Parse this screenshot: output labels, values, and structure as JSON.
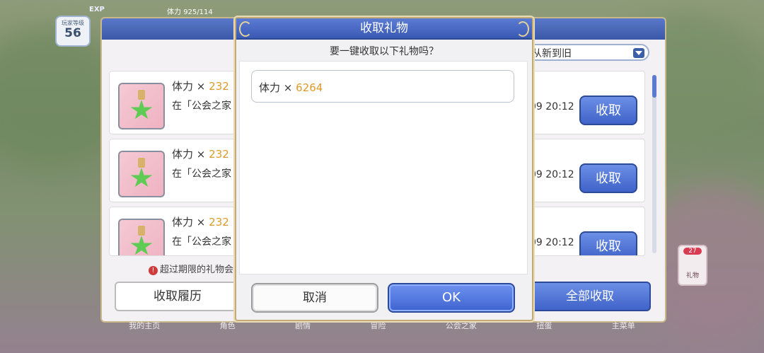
{
  "hud": {
    "level_label": "玩家等级",
    "level_value": "56",
    "exp_label": "EXP",
    "stamina_label": "体力",
    "stamina_value": "925/114"
  },
  "panel": {
    "sort_label": "从新到旧",
    "gifts": [
      {
        "name": "体力",
        "times": "×",
        "amount": "232",
        "desc": "在「公会之家",
        "date": "09  20:12",
        "claim_label": "收取"
      },
      {
        "name": "体力",
        "times": "×",
        "amount": "232",
        "desc": "在「公会之家",
        "date": "09  20:12",
        "claim_label": "收取"
      },
      {
        "name": "体力",
        "times": "×",
        "amount": "232",
        "desc": "在「公会之家",
        "date": "09  20:12",
        "claim_label": "收取"
      }
    ],
    "warning": "超过期限的礼物会",
    "history_button": "收取履历",
    "claim_all_button": "全部收取"
  },
  "bottom_nav": [
    "我的主页",
    "角色",
    "剧情",
    "冒险",
    "公会之家",
    "扭蛋",
    "主菜单"
  ],
  "side_badge": {
    "count": "27",
    "label": "礼物"
  },
  "modal": {
    "title": "收取礼物",
    "question": "要一键收取以下礼物吗？",
    "reward_name": "体力",
    "reward_times": "×",
    "reward_amount": "6264",
    "cancel_label": "取消",
    "ok_label": "OK"
  }
}
